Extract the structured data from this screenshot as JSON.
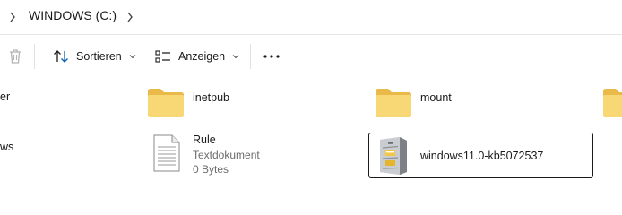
{
  "address_bar": {
    "path": "WINDOWS (C:)"
  },
  "command_bar": {
    "sort_label": "Sortieren",
    "view_label": "Anzeigen",
    "more_label": "..."
  },
  "items": {
    "partial_left_1": "er",
    "partial_left_2": "ws",
    "inetpub": {
      "name": "inetpub"
    },
    "mount": {
      "name": "mount"
    },
    "rule": {
      "name": "Rule",
      "type": "Textdokument",
      "size": "0 Bytes"
    },
    "kb": {
      "name": "windows11.0-kb5072537"
    }
  },
  "colors": {
    "folder": "#F8D775",
    "folder_dark": "#E9B949",
    "selection_border": "#1A1A1A",
    "accent": "#005FB8"
  }
}
